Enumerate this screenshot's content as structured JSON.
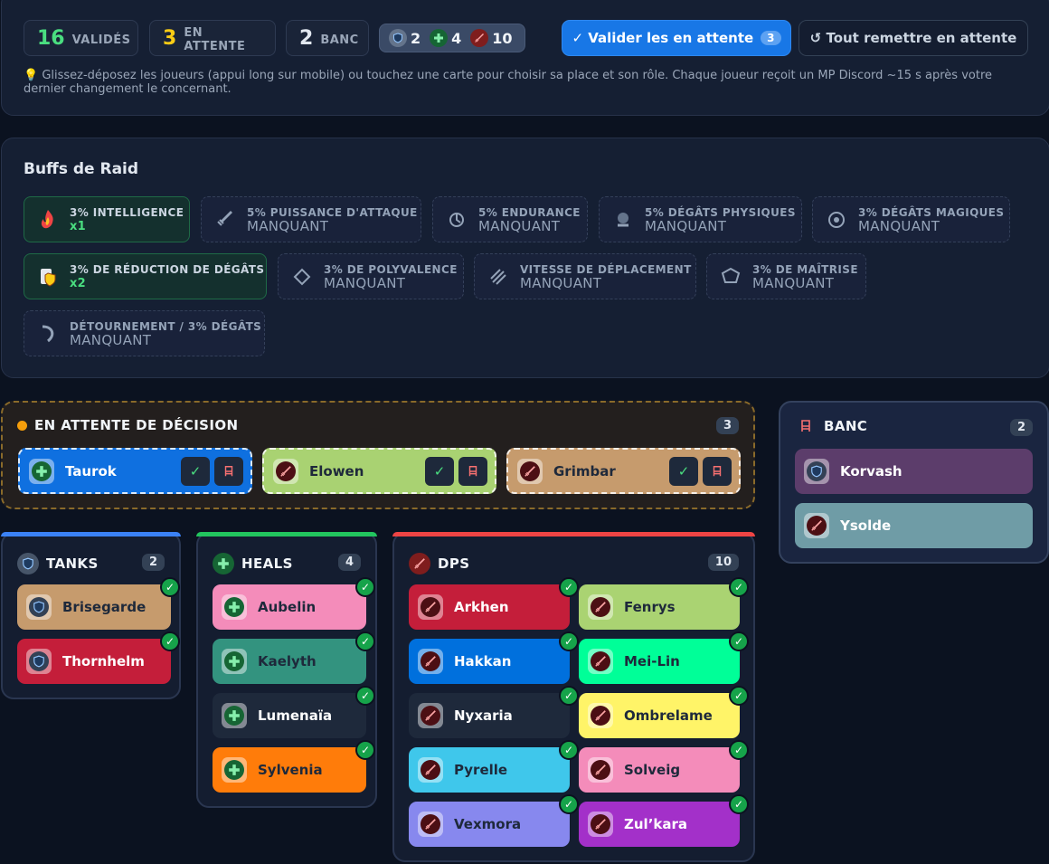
{
  "stats": {
    "validated": {
      "num": "16",
      "label": "VALIDÉS",
      "color": "#4ade80"
    },
    "pending": {
      "num": "3",
      "label": "EN ATTENTE",
      "color": "#facc15"
    },
    "bench": {
      "num": "2",
      "label": "BANC",
      "color": "#e2e8f0"
    }
  },
  "role_counts": {
    "tank": "2",
    "heal": "4",
    "dps": "10"
  },
  "actions": {
    "validate_label": "✓ Valider les en attente",
    "validate_count": "3",
    "reset_label": "↺ Tout remettre en attente"
  },
  "hint": "💡 Glissez-déposez les joueurs (appui long sur mobile) ou touchez une carte pour choisir sa place et son rôle. Chaque joueur reçoit un MP Discord ~15 s après votre dernier changement le concernant.",
  "buffs": {
    "title": "Buffs de Raid",
    "items": [
      {
        "name": "3% INTELLIGENCE",
        "value": "x1",
        "active": true,
        "icon": "flame-icon"
      },
      {
        "name": "5% PUISSANCE D'ATTAQUE",
        "value": "MANQUANT",
        "active": false,
        "icon": "sword-icon"
      },
      {
        "name": "5% ENDURANCE",
        "value": "MANQUANT",
        "active": false,
        "icon": "stamina-icon"
      },
      {
        "name": "5% DÉGÂTS PHYSIQUES",
        "value": "MANQUANT",
        "active": false,
        "icon": "fist-icon"
      },
      {
        "name": "3% DÉGÂTS MAGIQUES",
        "value": "MANQUANT",
        "active": false,
        "icon": "arcane-icon"
      },
      {
        "name": "3% DE RÉDUCTION DE DÉGÂTS",
        "value": "x2",
        "active": true,
        "icon": "shield-scroll-icon"
      },
      {
        "name": "3% DE POLYVALENCE",
        "value": "MANQUANT",
        "active": false,
        "icon": "versatility-icon"
      },
      {
        "name": "VITESSE DE DÉPLACEMENT",
        "value": "MANQUANT",
        "active": false,
        "icon": "speed-icon"
      },
      {
        "name": "3% DE MAÎTRISE",
        "value": "MANQUANT",
        "active": false,
        "icon": "mastery-icon"
      },
      {
        "name": "DÉTOURNEMENT / 3% DÉGÂTS",
        "value": "MANQUANT",
        "active": false,
        "icon": "leech-icon"
      }
    ]
  },
  "pending_section": {
    "title": "EN ATTENTE DE DÉCISION",
    "count": "3",
    "players": [
      {
        "name": "Taurok",
        "role": "heal",
        "color": "#0f70e0",
        "text": "light"
      },
      {
        "name": "Elowen",
        "role": "dps",
        "color": "#a9d272",
        "text": "dark"
      },
      {
        "name": "Grimbar",
        "role": "dps",
        "color": "#c69b6d",
        "text": "dark"
      }
    ]
  },
  "bench_section": {
    "title": "BANC",
    "count": "2",
    "players": [
      {
        "name": "Korvash",
        "role": "tank",
        "color": "#5c3d6b",
        "text": "light"
      },
      {
        "name": "Ysolde",
        "role": "dps",
        "color": "#6f9ca6",
        "text": "light"
      }
    ]
  },
  "tanks": {
    "title": "TANKS",
    "count": "2",
    "accent": "#3b82f6",
    "players": [
      {
        "name": "Brisegarde",
        "color": "#c69b6d",
        "text": "dark"
      },
      {
        "name": "Thornhelm",
        "color": "#c41e3a",
        "text": "light"
      }
    ]
  },
  "heals": {
    "title": "HEALS",
    "count": "4",
    "accent": "#22c55e",
    "players": [
      {
        "name": "Aubelin",
        "color": "#f48cba",
        "text": "dark"
      },
      {
        "name": "Kaelyth",
        "color": "#33937f",
        "text": "dark"
      },
      {
        "name": "Lumenaïa",
        "color": "#1e293b",
        "text": "light"
      },
      {
        "name": "Sylvenia",
        "color": "#ff7c0a",
        "text": "dark"
      }
    ]
  },
  "dps": {
    "title": "DPS",
    "count": "10",
    "accent": "#ef4444",
    "players": [
      {
        "name": "Arkhen",
        "color": "#c41e3a",
        "text": "light"
      },
      {
        "name": "Fenrys",
        "color": "#aad372",
        "text": "dark"
      },
      {
        "name": "Hakkan",
        "color": "#0070dd",
        "text": "light"
      },
      {
        "name": "Mei-Lin",
        "color": "#00ff98",
        "text": "dark"
      },
      {
        "name": "Nyxaria",
        "color": "#1e293b",
        "text": "light"
      },
      {
        "name": "Ombrelame",
        "color": "#fff468",
        "text": "dark"
      },
      {
        "name": "Pyrelle",
        "color": "#3fc7eb",
        "text": "dark"
      },
      {
        "name": "Solveig",
        "color": "#f48cba",
        "text": "dark"
      },
      {
        "name": "Vexmora",
        "color": "#8788ee",
        "text": "dark"
      },
      {
        "name": "Zul’kara",
        "color": "#a330c9",
        "text": "light"
      }
    ]
  }
}
